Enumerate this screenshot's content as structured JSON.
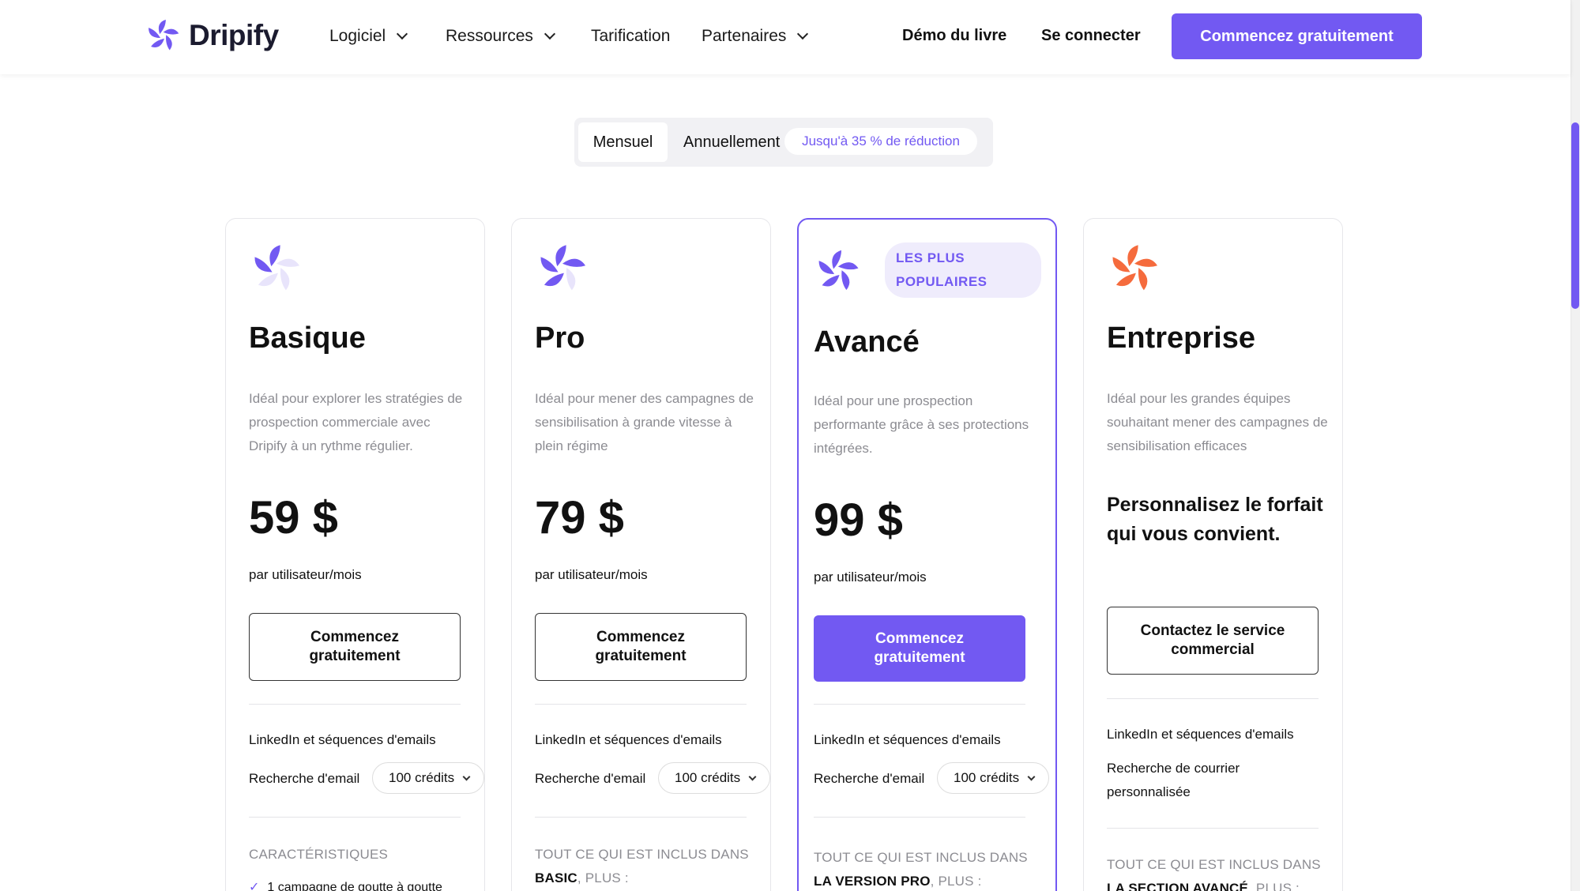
{
  "header": {
    "brand": "Dripify",
    "nav": [
      {
        "label": "Logiciel",
        "dropdown": true
      },
      {
        "label": "Ressources",
        "dropdown": true
      },
      {
        "label": "Tarification",
        "dropdown": false
      },
      {
        "label": "Partenaires",
        "dropdown": true
      }
    ],
    "demo_label": "Démo du livre",
    "login_label": "Se connecter",
    "cta_label": "Commencez gratuitement"
  },
  "billing_toggle": {
    "monthly": "Mensuel",
    "annual": "Annuellement",
    "badge": "Jusqu'à 35 % de réduction",
    "selected": "Mensuel"
  },
  "colors": {
    "accent": "#7259f2",
    "enterprise": "#f56b3d"
  },
  "plans": [
    {
      "name": "Basique",
      "icon": "dripify-petal-icon",
      "description": "Idéal pour explorer les stratégies de prospection commerciale avec Dripify à un rythme régulier.",
      "price": "59 $",
      "period": "par utilisateur/mois",
      "button": "Commencez gratuitement",
      "features": [
        "LinkedIn et séquences d'emails",
        "Recherche d'email"
      ],
      "credits": "100 crédits",
      "includes_prefix": "CARACTÉRISTIQUES",
      "first_item": "1 campagne de goutte à goutte"
    },
    {
      "name": "Pro",
      "icon": "dripify-petal-icon",
      "description": "Idéal pour mener des campagnes de sensibilisation à grande vitesse à plein régime",
      "price": "79 $",
      "period": "par utilisateur/mois",
      "button": "Commencez gratuitement",
      "features": [
        "LinkedIn et séquences d'emails",
        "Recherche d'email"
      ],
      "credits": "100 crédits",
      "includes_prefix": "TOUT CE QUI EST INCLUS DANS",
      "includes_plan": "BASIC",
      "includes_suffix": ", PLUS :"
    },
    {
      "name": "Avancé",
      "icon": "dripify-petal-icon",
      "badge": "LES PLUS POPULAIRES",
      "description": "Idéal pour une prospection performante grâce à ses protections intégrées.",
      "price": "99 $",
      "period": "par utilisateur/mois",
      "button": "Commencez gratuitement",
      "features": [
        "LinkedIn et séquences d'emails",
        "Recherche d'email"
      ],
      "credits": "100 crédits",
      "includes_prefix": "TOUT CE QUI EST INCLUS DANS",
      "includes_plan": "LA VERSION PRO",
      "includes_suffix": ", PLUS :"
    },
    {
      "name": "Entreprise",
      "icon": "dripify-petal-icon",
      "description": "Idéal pour les grandes équipes souhaitant mener des campagnes de sensibilisation efficaces",
      "lead": "Personnalisez le forfait qui vous convient.",
      "button": "Contactez le service commercial",
      "features": [
        "LinkedIn et séquences d'emails",
        "Recherche de courrier personnalisée"
      ],
      "includes_prefix": "TOUT CE QUI EST INCLUS DANS",
      "includes_plan": "LA SECTION AVANCÉ",
      "includes_suffix": ", PLUS :"
    }
  ]
}
